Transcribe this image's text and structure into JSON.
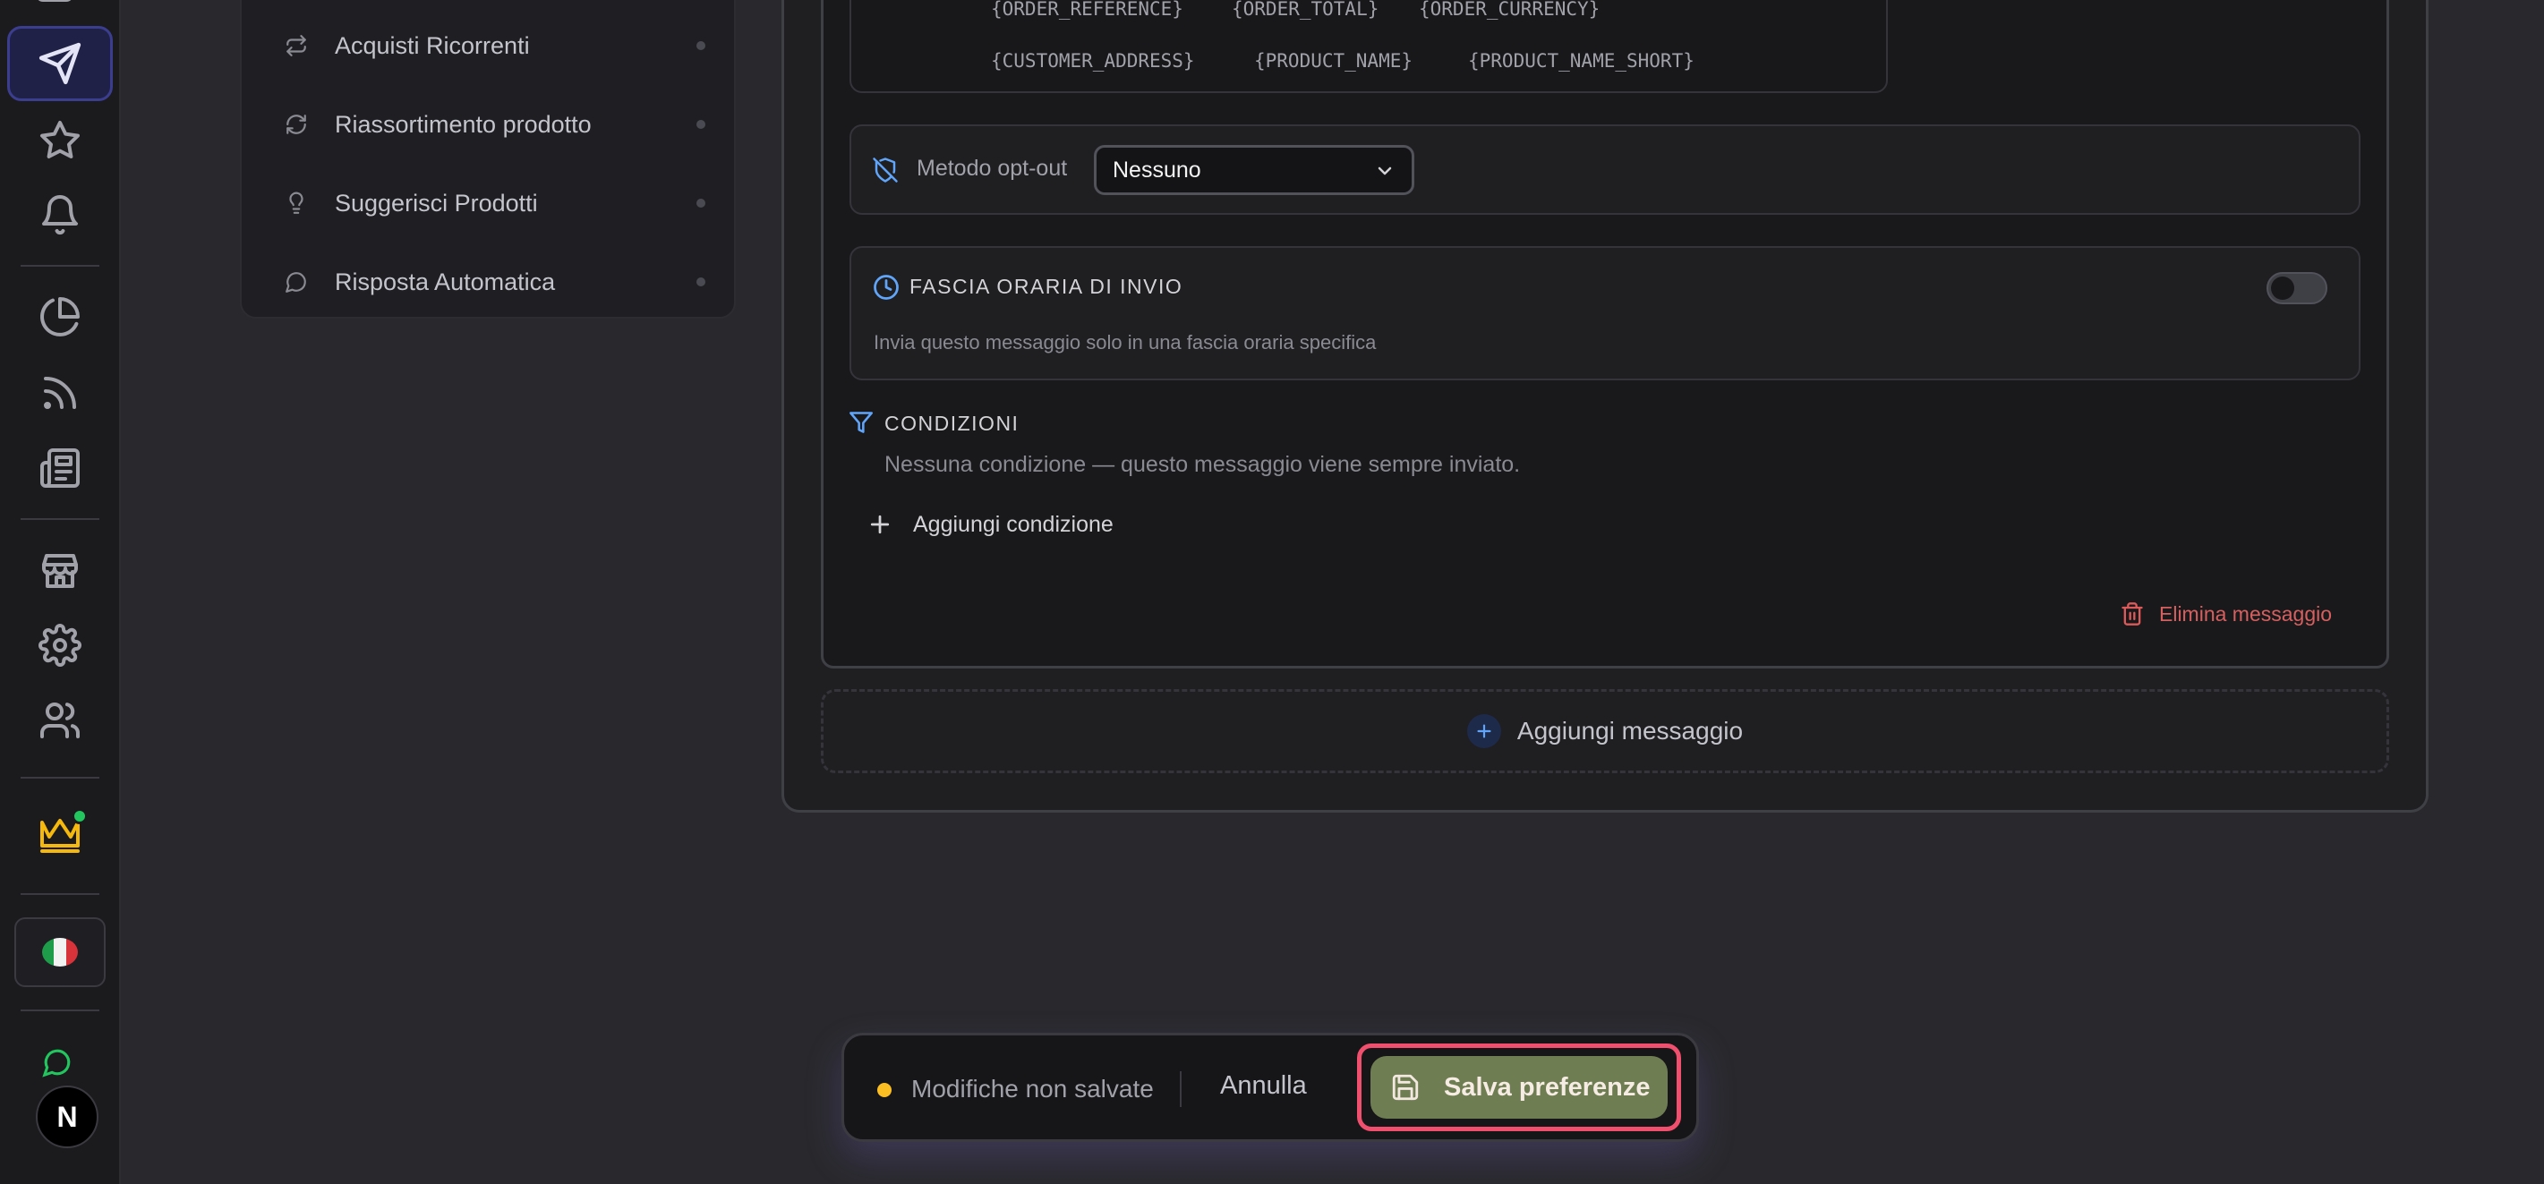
{
  "sidebar_rail": {
    "icons": [
      "send-icon",
      "star-icon",
      "bell-icon",
      "pie-chart-icon",
      "rss-icon",
      "newspaper-icon",
      "store-icon",
      "settings-icon",
      "users-icon",
      "crown-icon"
    ],
    "language_flag": "it",
    "avatar_letter": "N"
  },
  "submenu": {
    "items": [
      {
        "label": "Acquisti Ricorrenti",
        "icon": "repeat-icon"
      },
      {
        "label": "Riassortimento prodotto",
        "icon": "refresh-icon"
      },
      {
        "label": "Suggerisci Prodotti",
        "icon": "lightbulb-icon"
      },
      {
        "label": "Risposta Automatica",
        "icon": "message-circle-icon"
      }
    ]
  },
  "message": {
    "variables_row1": [
      "{ORDER_REFERENCE}",
      "{ORDER_TOTAL}",
      "{ORDER_CURRENCY}"
    ],
    "variables_row2": [
      "{CUSTOMER_ADDRESS}",
      "{PRODUCT_NAME}",
      "{PRODUCT_NAME_SHORT}"
    ],
    "optout": {
      "label": "Metodo opt-out",
      "selected": "Nessuno"
    },
    "time_window": {
      "title": "FASCIA ORARIA DI INVIO",
      "description": "Invia questo messaggio solo in una fascia oraria specifica",
      "enabled": false
    },
    "conditions": {
      "title": "CONDIZIONI",
      "empty_text": "Nessuna condizione — questo messaggio viene sempre inviato.",
      "add_label": "Aggiungi condizione"
    },
    "delete_label": "Elimina messaggio"
  },
  "add_message_label": "Aggiungi messaggio",
  "save_bar": {
    "status_text": "Modifiche non salvate",
    "cancel_label": "Annulla",
    "save_label": "Salva preferenze"
  },
  "colors": {
    "accent_blue": "#60a5fa",
    "save_button": "#6f7e52",
    "highlight_outline": "#f0506e",
    "delete_red": "#d65f5f",
    "unsaved_dot": "#fbbf24"
  }
}
